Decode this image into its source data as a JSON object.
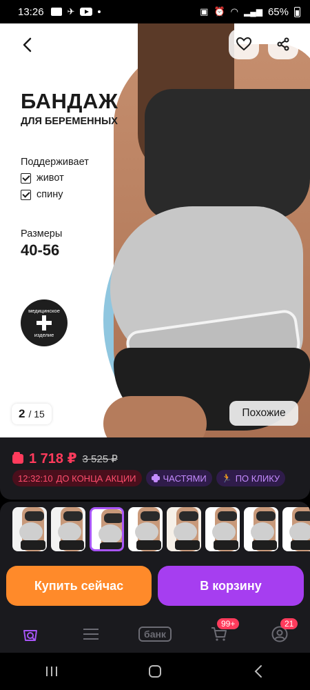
{
  "status_bar": {
    "time": "13:26",
    "battery": "65%"
  },
  "hero": {
    "title": "БАНДАЖ",
    "subtitle": "ДЛЯ БЕРЕМЕННЫХ",
    "supports_label": "Поддерживает",
    "checks": [
      "живот",
      "спину"
    ],
    "sizes_label": "Размеры",
    "sizes_value": "40-56",
    "badge_top": "медицинское",
    "badge_bottom": "изделие",
    "page_current": "2",
    "page_total": "/ 15",
    "similar_label": "Похожие"
  },
  "price": {
    "current": "1 718 ₽",
    "old": "3 525 ₽",
    "accent_color": "#ff3b5c"
  },
  "chips": {
    "timer_time": "12:32:10",
    "timer_text": "ДО КОНЦА АКЦИИ",
    "parts": "ЧАСТЯМИ",
    "click": "ПО КЛИКУ"
  },
  "thumbnails": {
    "count": 8,
    "active_index": 2
  },
  "buttons": {
    "buy": "Купить сейчас",
    "cart": "В корзину",
    "buy_color": "#ff8a2a",
    "cart_color": "#a63ef0"
  },
  "tabbar": {
    "bank": "банк",
    "cart_badge": "99+",
    "profile_badge": "21"
  }
}
